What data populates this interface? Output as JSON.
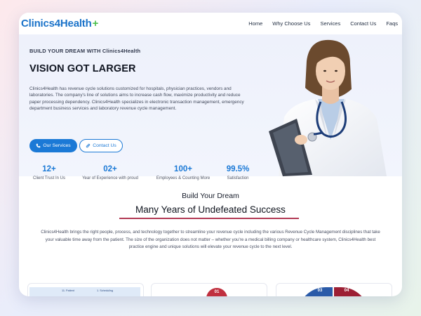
{
  "header": {
    "logo_text": "Clinics4Health",
    "logo_plus": "+",
    "nav": [
      "Home",
      "Why Choose Us",
      "Services",
      "Contact Us",
      "Faqs"
    ]
  },
  "hero": {
    "eyebrow": "BUILD YOUR DREAM WITH Clinics4Health",
    "title": "VISION GOT LARGER",
    "description": "Clinics4Health has revenue cycle solutions customized for hospitals, physician practices, vendors and laboratories. The company's line of solutions aims to increase cash flow, maximize productivity and reduce paper processing dependency. Clinics4Health specializes in electronic transaction management, emergency department business services and laboratory revenue cycle management.",
    "primary_button": "Our Services",
    "secondary_button": "Contact Us",
    "stats": [
      {
        "value": "12+",
        "label": "Client Trust In Us"
      },
      {
        "value": "02+",
        "label": "Year of Experience with proud"
      },
      {
        "value": "100+",
        "label": "Employees & Counting More"
      },
      {
        "value": "99.5%",
        "label": "Satisfaction"
      }
    ]
  },
  "section": {
    "subtitle": "Build Your Dream",
    "title": "Many Years of Undefeated Success",
    "description": "Clinics4Health brings the right people, process, and technology together to streamline your revenue cycle including the various Revenue Cycle Management disciplines that take your valuable time away from the patient. The size of the organization does not matter – whether you're a medical billing company or healthcare system, Clinics4Health best practice engine and unique solutions will elevate your revenue cycle to the next level."
  },
  "cards": {
    "card1_labels": [
      "11. Patient",
      "1. Scheduling"
    ],
    "card2_badge": "01",
    "card3_labels": [
      "03",
      "04"
    ]
  },
  "colors": {
    "brand_blue": "#1b79d6",
    "logo_green": "#4bbf4b",
    "accent_underline": "#b23a55"
  },
  "icons": {
    "primary_button_icon": "phone-icon",
    "secondary_button_icon": "link-icon"
  }
}
